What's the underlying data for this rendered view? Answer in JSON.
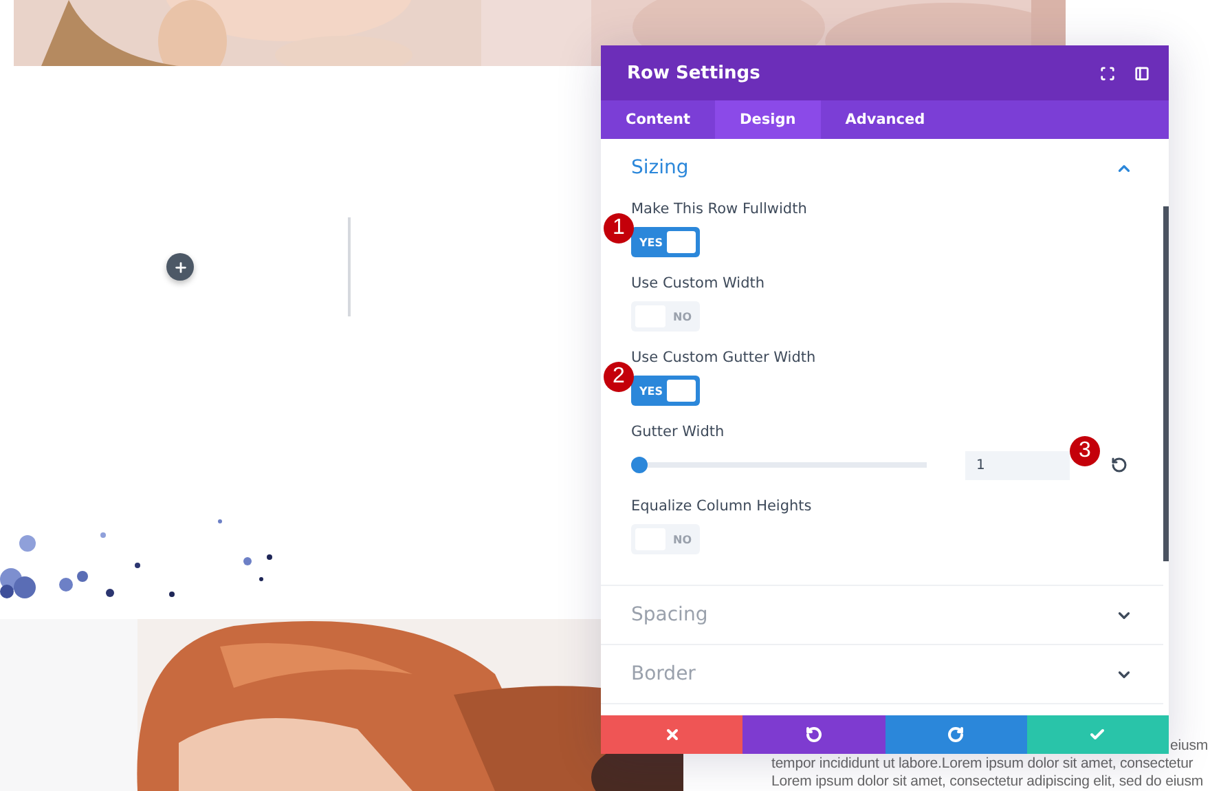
{
  "page": {
    "text_lines": [
      "eiusm",
      "tempor incididunt ut labore.Lorem ipsum dolor sit amet, consectetur",
      "Lorem ipsum dolor sit amet, consectetur adipiscing elit, sed do eiusm"
    ]
  },
  "panel": {
    "title": "Row Settings",
    "tabs": [
      {
        "label": "Content",
        "selected": false
      },
      {
        "label": "Design",
        "selected": true
      },
      {
        "label": "Advanced",
        "selected": false
      }
    ],
    "sections": [
      {
        "title": "Sizing",
        "expanded": true,
        "fields": [
          {
            "kind": "toggle",
            "label": "Make This Row Fullwidth",
            "on": true,
            "text": "YES",
            "callout": "1"
          },
          {
            "kind": "toggle",
            "label": "Use Custom Width",
            "on": false,
            "text": "NO"
          },
          {
            "kind": "toggle",
            "label": "Use Custom Gutter Width",
            "on": true,
            "text": "YES",
            "callout": "2"
          },
          {
            "kind": "range",
            "label": "Gutter Width",
            "level": 0,
            "value": "1",
            "callout": "3"
          },
          {
            "kind": "toggle",
            "label": "Equalize Column Heights",
            "on": false,
            "text": "NO"
          }
        ]
      },
      {
        "title": "Spacing",
        "expanded": false
      },
      {
        "title": "Border",
        "expanded": false
      }
    ],
    "footer_buttons": [
      {
        "kind": "cancel"
      },
      {
        "kind": "undo"
      },
      {
        "kind": "redo"
      },
      {
        "kind": "save"
      }
    ]
  }
}
